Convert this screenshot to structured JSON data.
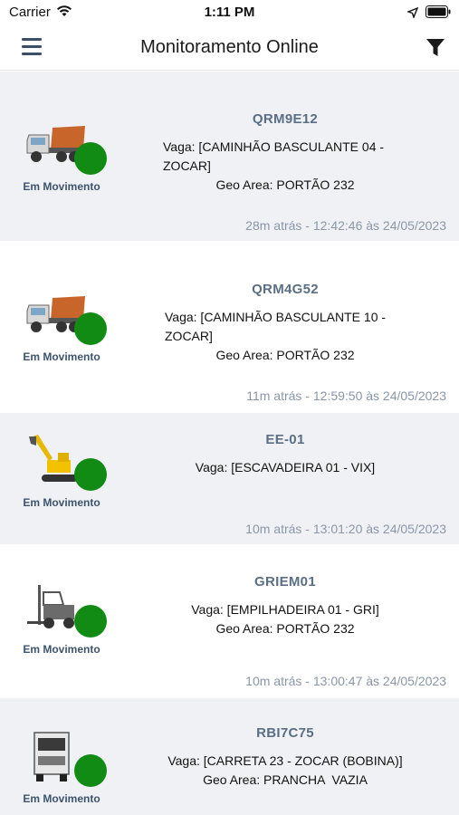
{
  "status_bar": {
    "carrier": "Carrier",
    "time": "1:11 PM"
  },
  "header": {
    "title": "Monitoramento Online",
    "menu_icon": "hamburger-menu-icon",
    "filter_icon": "filter-icon"
  },
  "colors": {
    "status_dot": "#118b14",
    "alt_row": "#f0f1f5",
    "plate": "#5a6f85",
    "timestamp": "#8a97a8"
  },
  "vehicles": [
    {
      "plate": "QRM9E12",
      "vaga_line1": "Vaga: [CAMINHÃO BASCULANTE 04 -",
      "vaga_line2": "ZOCAR]",
      "geo": "Geo Area: PORTÃO 232",
      "time": "28m atrás - 12:42:46 às 24/05/2023",
      "status": "Em Movimento",
      "icon": "dump-truck-icon"
    },
    {
      "plate": "QRM4G52",
      "vaga_line1": "Vaga: [CAMINHÃO BASCULANTE 10 -",
      "vaga_line2": "ZOCAR]",
      "geo": "Geo Area: PORTÃO 232",
      "time": "11m atrás - 12:59:50 às 24/05/2023",
      "status": "Em Movimento",
      "icon": "dump-truck-icon"
    },
    {
      "plate": "EE-01",
      "vaga_line1": "Vaga: [ESCAVADEIRA 01 - VIX]",
      "vaga_line2": "",
      "geo": "",
      "time": "10m atrás - 13:01:20 às 24/05/2023",
      "status": "Em Movimento",
      "icon": "excavator-icon"
    },
    {
      "plate": "GRIEM01",
      "vaga_line1": "Vaga: [EMPILHADEIRA 01 - GRI]",
      "vaga_line2": "",
      "geo": "Geo Area: PORTÃO 232",
      "time": "10m atrás - 13:00:47 às 24/05/2023",
      "status": "Em Movimento",
      "icon": "forklift-icon"
    },
    {
      "plate": "RBI7C75",
      "vaga_line1": "Vaga: [CARRETA 23 - ZOCAR (BOBINA)]",
      "vaga_line2": "",
      "geo": "Geo Area: PRANCHA  VAZIA",
      "time": "",
      "status": "Em Movimento",
      "icon": "truck-icon"
    }
  ]
}
